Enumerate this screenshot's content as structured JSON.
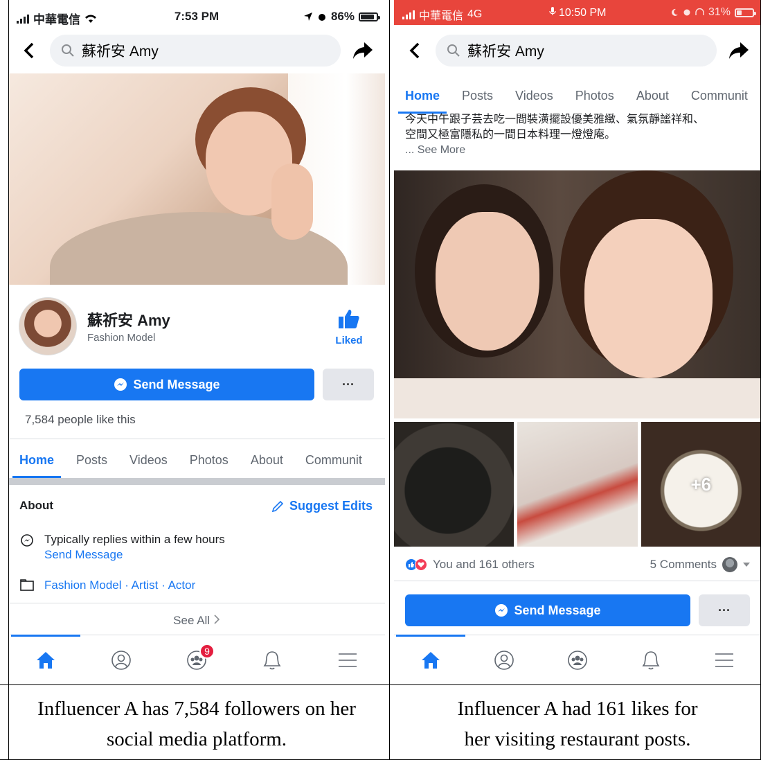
{
  "left": {
    "status": {
      "carrier": "中華電信",
      "time": "7:53 PM",
      "battery": "86%"
    },
    "search": {
      "query": "蘇祈安 Amy"
    },
    "profile": {
      "name": "蘇祈安 Amy",
      "category": "Fashion Model",
      "liked_label": "Liked"
    },
    "actions": {
      "send_message": "Send Message",
      "more": "···"
    },
    "likes_text": "7,584 people like this",
    "tabs": [
      "Home",
      "Posts",
      "Videos",
      "Photos",
      "About",
      "Communit"
    ],
    "about": {
      "title": "About",
      "suggest_edits": "Suggest Edits",
      "reply_text": "Typically replies within a few hours",
      "reply_link": "Send Message",
      "categories": "Fashion Model · Artist · Actor",
      "see_all": "See All"
    },
    "nav": {
      "groups_badge": "9"
    }
  },
  "right": {
    "status": {
      "carrier": "中華電信",
      "network": "4G",
      "time": "10:50 PM",
      "battery": "31%"
    },
    "search": {
      "query": "蘇祈安 Amy"
    },
    "tabs": [
      "Home",
      "Posts",
      "Videos",
      "Photos",
      "About",
      "Communit"
    ],
    "post": {
      "text_line1": "今天中午跟子芸去吃一間裝潢擺設優美雅緻、氣氛靜謐祥和、",
      "text_line2": "空間又極富隱私的一間日本料理一燈燈庵。",
      "see_more": "... See More",
      "more_photos": "+6",
      "reactions_text": "You and 161 others",
      "comments_text": "5 Comments"
    },
    "actions": {
      "send_message": "Send Message",
      "more": "···"
    }
  },
  "captions": {
    "left_line1": "Influencer A has 7,584 followers on her",
    "left_line2": "social media platform.",
    "right_line1": "Influencer A had 161 likes for",
    "right_line2": "her visiting restaurant posts."
  },
  "colors": {
    "facebook_blue": "#1877f2",
    "status_red": "#e8453c",
    "badge_red": "#e41e3f"
  },
  "icons": [
    "back-chevron-icon",
    "search-icon",
    "share-arrow-icon",
    "thumbs-up-icon",
    "messenger-icon",
    "pencil-icon",
    "messenger-outline-icon",
    "category-icon",
    "chevron-right-icon",
    "home-icon",
    "profile-icon",
    "groups-icon",
    "bell-icon",
    "menu-icon",
    "like-reaction-icon",
    "love-reaction-icon"
  ]
}
